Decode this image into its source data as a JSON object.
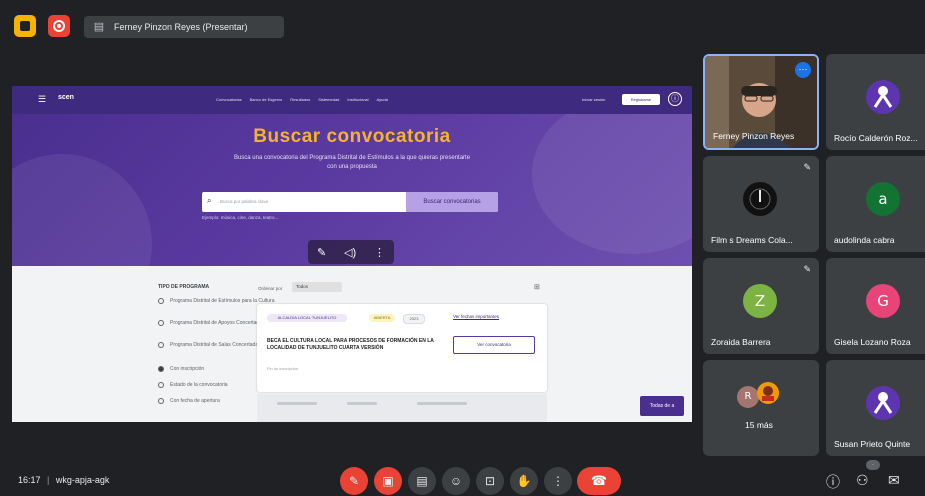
{
  "top_bar": {
    "presenter_label": "Ferney Pinzon Reyes (Presentar)"
  },
  "shared_screen": {
    "nav": {
      "logo_text": "scen",
      "links": [
        "Convocatorias",
        "Banco de Esgerxo",
        "Resultados",
        "Sistemedad",
        "Institucional",
        "Ayuda"
      ],
      "login_label": "Iniciar sesión",
      "register_label": "Registrarse"
    },
    "hero": {
      "title": "Buscar convocatoria",
      "subtitle": "Busca una convocatoria del Programa Distrital de Estímulos a la que quieras presentarte con una propuesta",
      "search_placeholder": "Busca por palabra clave",
      "search_button": "Buscar convocatorias",
      "search_hint": "Ejemplo: música, cine, danza, teatro..."
    },
    "filters": {
      "heading": "TIPO DE PROGRAMA",
      "options": [
        {
          "label": "Programa Distrital de Estímulos para la Cultura",
          "selected": false
        },
        {
          "label": "Programa Distrital de Apoyos Concertados",
          "selected": false
        },
        {
          "label": "Programa Distrital de Salas Concertadas",
          "selected": false
        },
        {
          "label": "Con inscripción",
          "selected": true
        },
        {
          "label": "Estado de la convocatoria",
          "selected": false
        },
        {
          "label": "Con fecha de apertura",
          "selected": false
        }
      ]
    },
    "sort": {
      "label": "Ordenar por",
      "value": "Todos"
    },
    "card": {
      "tags": [
        "ALCALDIA LOCAL TUNJUELITO",
        "ABIERTA",
        "2023"
      ],
      "link": "Ver fechas importantes",
      "title": "BECA EL CULTURA LOCAL PARA PROCESOS DE FORMACIÓN EN LA LOCALIDAD DE TUNJUELITO CUARTA VERSIÓN",
      "subtitle": "Fin de inscripción",
      "button": "Ver convocatoria"
    },
    "fab_label": "Todas de a"
  },
  "participants": [
    {
      "name": "Ferney Pinzon Reyes",
      "type": "video",
      "muted": false,
      "color": "#5a4a3a"
    },
    {
      "name": "Rocío Calderón Roz...",
      "type": "avatar-image",
      "muted": true,
      "color": "#5e35b1"
    },
    {
      "name": "Film s Dreams Cola...",
      "type": "avatar-image",
      "muted": true,
      "color": "#111111"
    },
    {
      "name": "audolinda cabra",
      "type": "initial",
      "initial": "a",
      "muted": true,
      "color": "#137333"
    },
    {
      "name": "Zoraida Barrera",
      "type": "initial",
      "initial": "Z",
      "muted": true,
      "color": "#7cb342"
    },
    {
      "name": "Gisela Lozano Roza",
      "type": "initial",
      "initial": "G",
      "muted": true,
      "color": "#e8447a"
    },
    {
      "name": "15 más",
      "type": "more",
      "initial": "R",
      "muted": false,
      "color": "#a5756f"
    },
    {
      "name": "Susan Prieto Quinte",
      "type": "avatar-image",
      "muted": true,
      "color": "#5e35b1"
    }
  ],
  "bottom_bar": {
    "time": "16:17",
    "meeting_code": "wkg-apja-agk"
  },
  "icons": {
    "mic": "mic-off-icon",
    "camera": "camera-off-icon",
    "captions": "captions-icon",
    "emoji": "emoji-icon",
    "present": "present-icon",
    "hand": "raise-hand-icon",
    "more": "more-icon",
    "hangup": "hangup-icon",
    "info": "info-icon",
    "people": "people-icon",
    "chat": "chat-icon"
  },
  "colors": {
    "meet_bg": "#202124",
    "tile_bg": "#3c4043",
    "site_purple": "#3e2a7f",
    "hero_title": "#f4b233",
    "danger": "#ea4335"
  }
}
